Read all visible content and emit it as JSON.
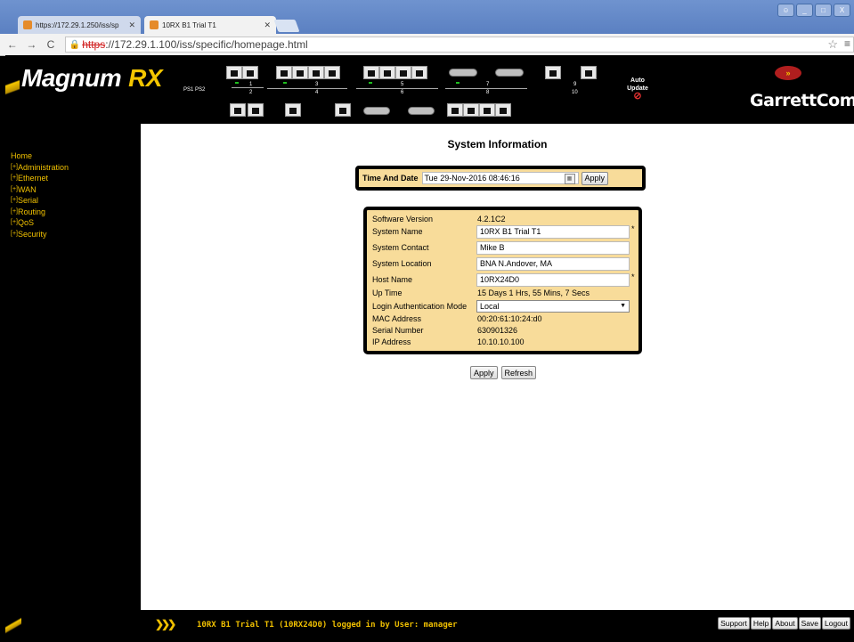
{
  "browser": {
    "tabs": [
      {
        "title": "https://172.29.1.250/iss/sp"
      },
      {
        "title": "10RX B1 Trial T1"
      }
    ],
    "url_scheme": "https",
    "url_rest": "://172.29.1.100/iss/specific/homepage.html",
    "window_controls": [
      "_",
      "□",
      "X"
    ]
  },
  "header": {
    "logo_main": "Magnum",
    "logo_suffix": "RX",
    "ps_labels": "PS1  PS2",
    "port_numbers": [
      "1",
      "2",
      "3",
      "4",
      "5",
      "6",
      "7",
      "8",
      "9",
      "10"
    ],
    "auto_update": "Auto Update",
    "brand": "GarrettCom"
  },
  "sidebar": {
    "items": [
      {
        "label": "Home",
        "prefix": ""
      },
      {
        "label": "Administration",
        "prefix": "[+]"
      },
      {
        "label": "Ethernet",
        "prefix": "[+]"
      },
      {
        "label": "WAN",
        "prefix": "[+]"
      },
      {
        "label": "Serial",
        "prefix": "[+]"
      },
      {
        "label": "Routing",
        "prefix": "[+]"
      },
      {
        "label": "QoS",
        "prefix": "[+]"
      },
      {
        "label": "Security",
        "prefix": "[+]"
      }
    ]
  },
  "main": {
    "title": "System Information",
    "time_date": {
      "label": "Time And Date",
      "value": "Tue 29-Nov-2016 08:46:16",
      "apply": "Apply"
    },
    "system": {
      "software_version": {
        "label": "Software Version",
        "value": "4.2.1C2"
      },
      "system_name": {
        "label": "System Name",
        "value": "10RX B1 Trial T1"
      },
      "system_contact": {
        "label": "System Contact",
        "value": "Mike B"
      },
      "system_location": {
        "label": "System Location",
        "value": "BNA N.Andover, MA"
      },
      "host_name": {
        "label": "Host Name",
        "value": "10RX24D0"
      },
      "up_time": {
        "label": "Up Time",
        "value": "15 Days 1 Hrs, 55 Mins, 7 Secs"
      },
      "login_auth": {
        "label": "Login Authentication Mode",
        "value": "Local"
      },
      "mac": {
        "label": "MAC Address",
        "value": "00:20:61:10:24:d0"
      },
      "serial": {
        "label": "Serial Number",
        "value": "630901326"
      },
      "ip": {
        "label": "IP Address",
        "value": "10.10.10.100"
      },
      "required_mark": "*"
    },
    "buttons": {
      "apply": "Apply",
      "refresh": "Refresh"
    }
  },
  "status": {
    "arrows": "❯❯❯",
    "text": "10RX B1 Trial T1 (10RX24D0) logged in by User: manager",
    "buttons": [
      "Support",
      "Help",
      "About",
      "Save",
      "Logout"
    ]
  }
}
